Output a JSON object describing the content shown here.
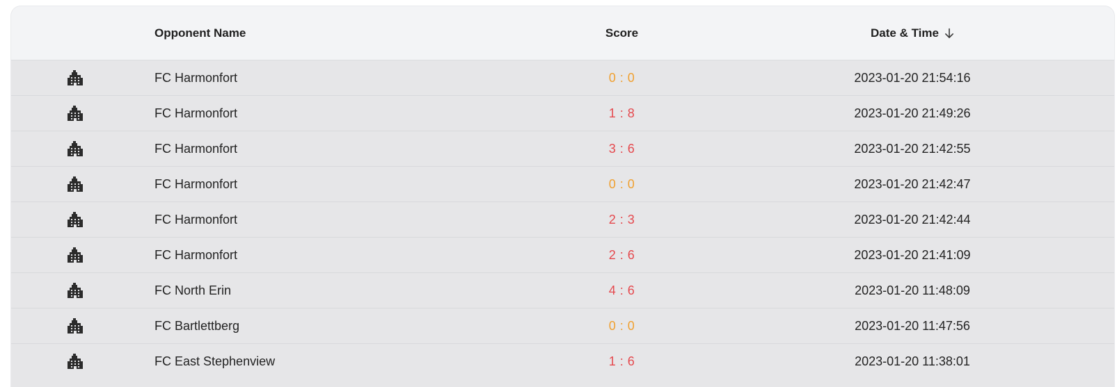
{
  "table": {
    "columns": {
      "icon": "",
      "opponent": "Opponent Name",
      "score": "Score",
      "date": "Date & Time"
    },
    "sort": {
      "column": "date",
      "direction": "descending",
      "icon": "arrow-down-icon"
    },
    "row_icon": "buildings-icon",
    "score_colors": {
      "draw": "#f0a030",
      "loss": "#e5484d"
    },
    "rows": [
      {
        "opponent": "FC Harmonfort",
        "score": "0 : 0",
        "result": "draw",
        "date": "2023-01-20 21:54:16"
      },
      {
        "opponent": "FC Harmonfort",
        "score": "1 : 8",
        "result": "loss",
        "date": "2023-01-20 21:49:26"
      },
      {
        "opponent": "FC Harmonfort",
        "score": "3 : 6",
        "result": "loss",
        "date": "2023-01-20 21:42:55"
      },
      {
        "opponent": "FC Harmonfort",
        "score": "0 : 0",
        "result": "draw",
        "date": "2023-01-20 21:42:47"
      },
      {
        "opponent": "FC Harmonfort",
        "score": "2 : 3",
        "result": "loss",
        "date": "2023-01-20 21:42:44"
      },
      {
        "opponent": "FC Harmonfort",
        "score": "2 : 6",
        "result": "loss",
        "date": "2023-01-20 21:41:09"
      },
      {
        "opponent": "FC North Erin",
        "score": "4 : 6",
        "result": "loss",
        "date": "2023-01-20 11:48:09"
      },
      {
        "opponent": "FC Bartlettberg",
        "score": "0 : 0",
        "result": "draw",
        "date": "2023-01-20 11:47:56"
      },
      {
        "opponent": "FC East Stephenview",
        "score": "1 : 6",
        "result": "loss",
        "date": "2023-01-20 11:38:01"
      }
    ]
  }
}
